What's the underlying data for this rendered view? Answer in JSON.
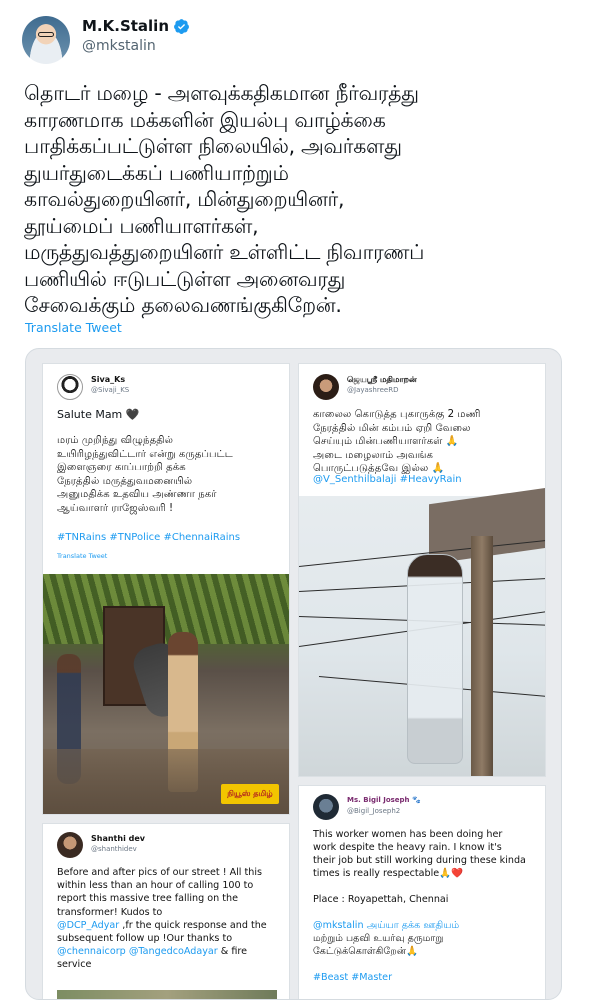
{
  "author": {
    "name": "M.K.Stalin",
    "handle": "@mkstalin"
  },
  "tweet": {
    "lines": [
      "தொடர் மழை - அளவுக்கதிகமான நீர்வரத்து",
      "காரணமாக மக்களின் இயல்பு வாழ்க்கை",
      "பாதிக்கப்பட்டுள்ள நிலையில், அவர்களது",
      "துயர்துடைக்கப் பணியாற்றும்",
      "காவல்துறையினர், மின்துறையினர்,",
      "தூய்மைப் பணியாளர்கள்,",
      "மருத்துவத்துறையினர் உள்ளிட்ட நிவாரணப்",
      "பணியில் ஈடுபட்டுள்ள அனைவரது",
      "சேவைக்கும் தலைவணங்குகிறேன்."
    ],
    "translate_label": "Translate Tweet"
  },
  "cards": {
    "card1": {
      "name": "Siva_Ks",
      "handle": "@Sivaji_KS",
      "salute": "Salute Mam 🖤",
      "lines": [
        "மரம் முறிந்து விழுந்ததில்",
        "உயிரிழந்துவிட்டார் என்று கருதப்பட்ட",
        "இளைஞரை காப்பாற்றி தக்க",
        "நேரத்தில் மருத்துவமனையில்",
        "அனுமதிக்க உதவிய அண்ணா நகர்",
        "ஆய்வாளர் ராஜேஸ்வரி !"
      ],
      "tags": "#TNRains #TNPolice #ChennaiRains",
      "translate": "Translate Tweet",
      "badge": "நியூஸ் தமிழ்"
    },
    "card2": {
      "name": "ஜெயஸ்ரீ மதிமாறன்",
      "handle": "@JayashreeRD",
      "lines": [
        "காலைல கொடுத்த புகாருக்கு 2 மணி",
        "நேரத்தில் மின் கம்பம் ஏறி வேலை",
        "செய்யும் மின்பணியாளர்கள் 🙏",
        "அடை மழைலாம் அவங்க",
        "பொருட்படுத்தவே இல்ல 🙏"
      ],
      "tags": "@V_Senthilbalaji #HeavyRain"
    },
    "card3": {
      "name": "Ms. Bigil Joseph 🐾",
      "handle": "@Bigil_Joseph2",
      "lines": [
        "This worker women has been doing her",
        "work despite the heavy rain. I know it's",
        "their job but still working during these kinda",
        "times is really respectable🙏❤️",
        "",
        "Place : Royapettah, Chennai",
        "",
        "@mkstalin அய்யா தக்க ஊதியம்",
        "மற்றும் பதவி உயர்வு தருமாறு",
        "கேட்டுக்கொள்கிறேன்🙏",
        "",
        "#Beast #Master"
      ]
    },
    "card4": {
      "name": "Shanthi dev",
      "handle": "@shanthidev",
      "lines": [
        "Before and after pics of our street ! All this",
        "within less than an hour of calling 100  to",
        "report this massive tree falling on the",
        "transformer! Kudos to",
        "@DCP_Adyar ,fr the quick response and the",
        "subsequent follow up !Our thanks to",
        "@chennaicorp @TangedcoAdayar & fire",
        "service"
      ]
    }
  },
  "colors": {
    "link": "#1d9bf0",
    "text": "#0f1419",
    "muted": "#536471"
  },
  "icons": [
    "verified-badge-icon"
  ]
}
